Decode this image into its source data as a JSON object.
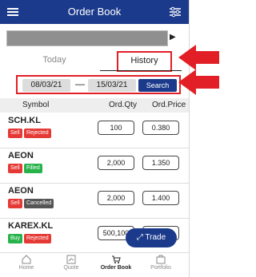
{
  "header": {
    "title": "Order Book",
    "menu_icon": "hamburger-icon",
    "filter_icon": "filter-icon"
  },
  "tabs": [
    {
      "label": "Today"
    },
    {
      "label": "History"
    }
  ],
  "dates": {
    "from": "08/03/21",
    "to": "15/03/21",
    "search_label": "Search"
  },
  "table": {
    "headers": [
      "Symbol",
      "Ord.Qty",
      "Ord.Price"
    ],
    "rows": [
      {
        "symbol": "SCH.KL",
        "side": "Sell",
        "status": "Rejected",
        "qty": "100",
        "price": "0.380"
      },
      {
        "symbol": "AEON",
        "side": "Sell",
        "status": "Filled",
        "qty": "2,000",
        "price": "1.350"
      },
      {
        "symbol": "AEON",
        "side": "Sell",
        "status": "Cancelled",
        "qty": "2,000",
        "price": "1.400"
      },
      {
        "symbol": "KAREX.KL",
        "side": "Buy",
        "status": "Rejected",
        "qty": "500,100",
        "price": ""
      }
    ]
  },
  "trade_button": {
    "label": "Trade"
  },
  "nav": [
    {
      "label": "Home"
    },
    {
      "label": "Quote"
    },
    {
      "label": "Order Book"
    },
    {
      "label": "Portfolio"
    }
  ],
  "colors": {
    "primary": "#1b3a8c",
    "highlight": "#e21f26",
    "sell": "#e53935",
    "buy": "#27b24a"
  }
}
